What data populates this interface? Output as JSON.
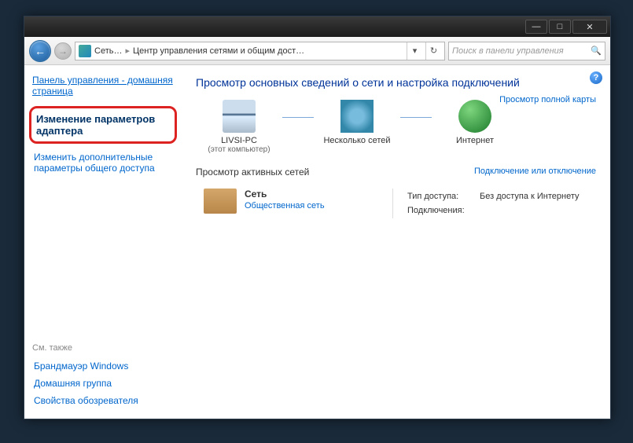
{
  "titlebar": {
    "minimize": "—",
    "maximize": "□",
    "close": "✕"
  },
  "nav": {
    "back": "←",
    "fwd": "→",
    "path_net": "Сеть…",
    "path_sep": "▸",
    "path_title": "Центр управления сетями и общим дост…",
    "dropdown": "▾",
    "refresh": "↻"
  },
  "search": {
    "placeholder": "Поиск в панели управления",
    "icon": "🔍"
  },
  "sidebar": {
    "cp_home": "Панель управления - домашняя страница",
    "task_adapter": "Изменение параметров адаптера",
    "task_sharing": "Изменить дополнительные параметры общего доступа",
    "see_also": "См. также",
    "firewall": "Брандмауэр Windows",
    "homegroup": "Домашняя группа",
    "inet_options": "Свойства обозревателя"
  },
  "content": {
    "help": "?",
    "heading": "Просмотр основных сведений о сети и настройка подключений",
    "map_full": "Просмотр полной карты",
    "map": {
      "pc_name": "LIVSI-PC",
      "pc_sub": "(этот компьютер)",
      "multi": "Несколько сетей",
      "internet": "Интернет"
    },
    "active_hd": "Просмотр активных сетей",
    "connect_link": "Подключение или отключение",
    "network": {
      "name": "Сеть",
      "type": "Общественная сеть",
      "access_k": "Тип доступа:",
      "access_v": "Без доступа к Интернету",
      "conn_k": "Подключения:"
    }
  }
}
